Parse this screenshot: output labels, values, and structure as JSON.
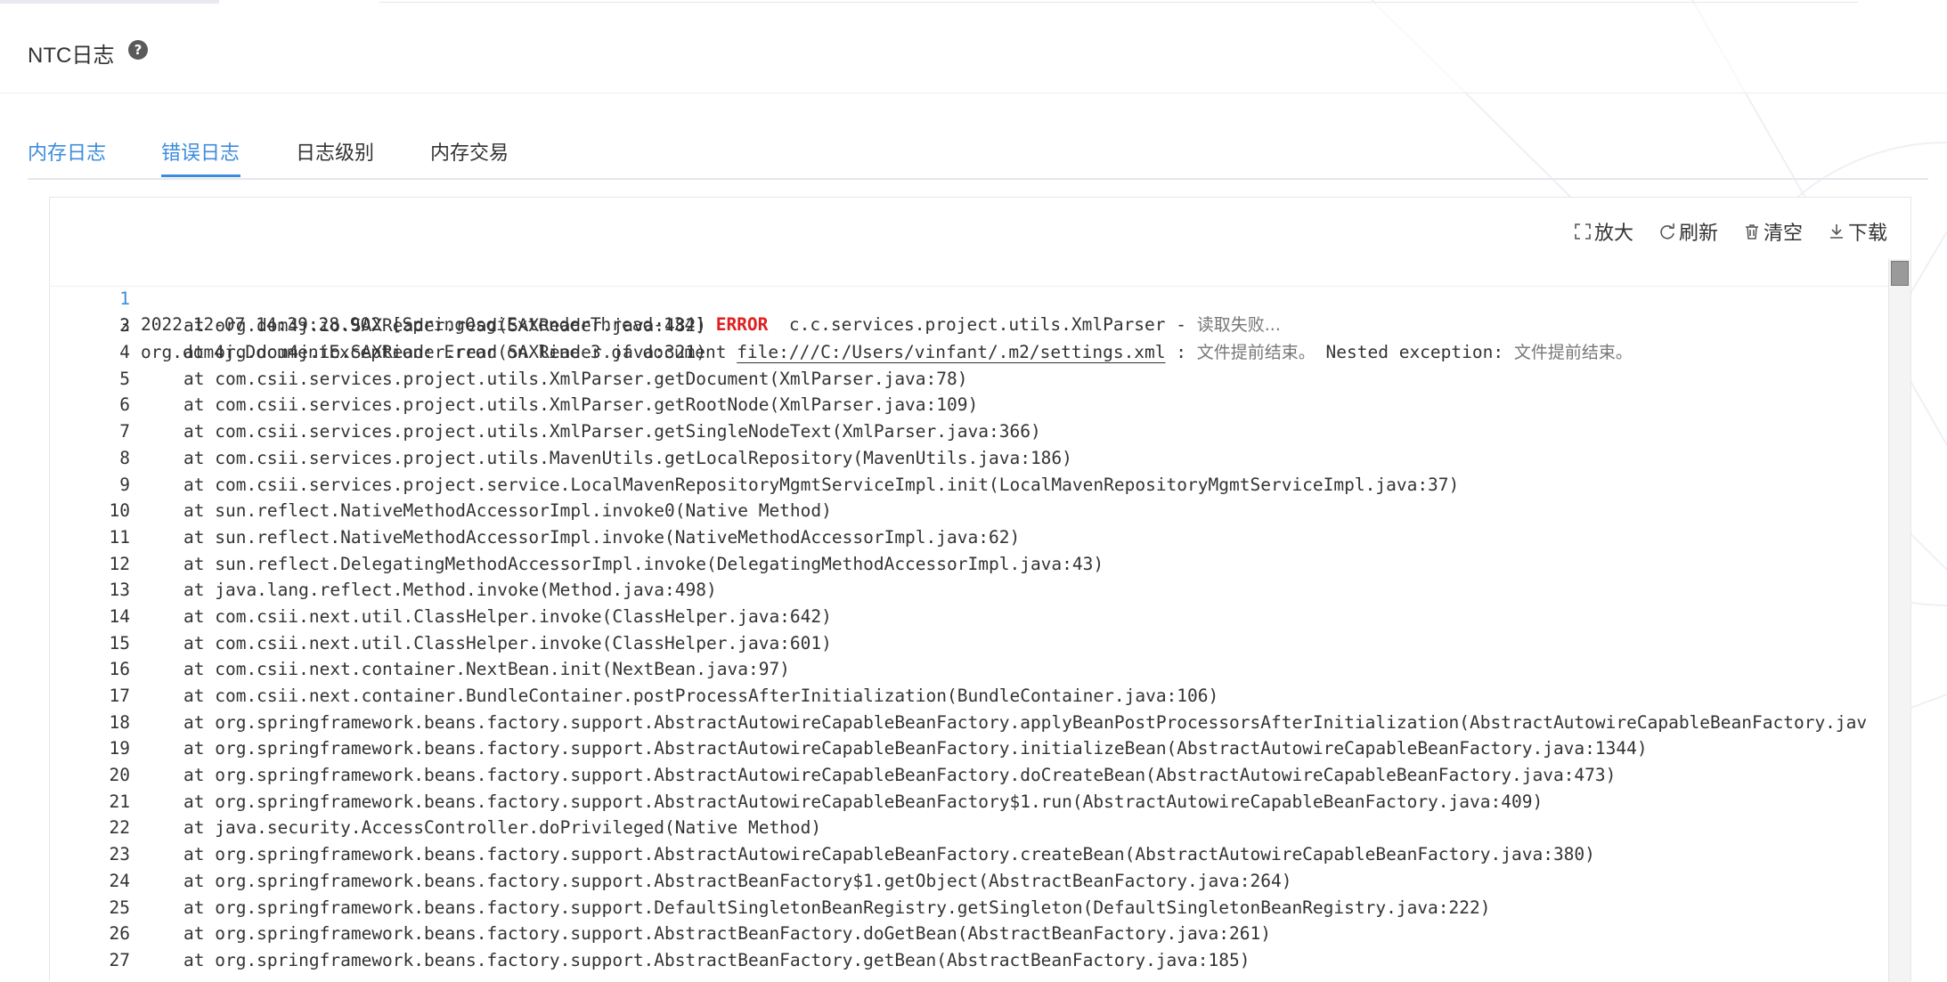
{
  "header": {
    "title": "NTC日志",
    "help_icon": "question-circle-icon"
  },
  "tabs": [
    {
      "label": "内存日志"
    },
    {
      "label": "错误日志"
    },
    {
      "label": "日志级别"
    },
    {
      "label": "内存交易"
    }
  ],
  "toolbar": {
    "zoom_label": "放大",
    "refresh_label": "刷新",
    "clear_label": "清空",
    "download_label": "下载"
  },
  "log": {
    "line1": {
      "num": "1",
      "prefix": "2022-12-07 14:39:28.902 [SpringOsgiExtenderThread-134] ",
      "level": "ERROR",
      "middle": "  c.c.services.project.utils.XmlParser - ",
      "cn": "读取失败..."
    },
    "line2": {
      "num": "2",
      "prefix": "org.dom4j.DocumentException: Error on line 3 of document ",
      "link": "file:///C:/Users/vinfant/.m2/settings.xml",
      "sep1": " : ",
      "cn1": "文件提前结束。",
      "mid": " Nested exception: ",
      "cn2": "文件提前结束。"
    },
    "lines": [
      {
        "num": "3",
        "text": "at org.dom4j.io.SAXReader.read(SAXReader.java:482)"
      },
      {
        "num": "4",
        "text": "at org.dom4j.io.SAXReader.read(SAXReader.java:321)"
      },
      {
        "num": "5",
        "text": "at com.csii.services.project.utils.XmlParser.getDocument(XmlParser.java:78)"
      },
      {
        "num": "6",
        "text": "at com.csii.services.project.utils.XmlParser.getRootNode(XmlParser.java:109)"
      },
      {
        "num": "7",
        "text": "at com.csii.services.project.utils.XmlParser.getSingleNodeText(XmlParser.java:366)"
      },
      {
        "num": "8",
        "text": "at com.csii.services.project.utils.MavenUtils.getLocalRepository(MavenUtils.java:186)"
      },
      {
        "num": "9",
        "text": "at com.csii.services.project.service.LocalMavenRepositoryMgmtServiceImpl.init(LocalMavenRepositoryMgmtServiceImpl.java:37)"
      },
      {
        "num": "10",
        "text": "at sun.reflect.NativeMethodAccessorImpl.invoke0(Native Method)"
      },
      {
        "num": "11",
        "text": "at sun.reflect.NativeMethodAccessorImpl.invoke(NativeMethodAccessorImpl.java:62)"
      },
      {
        "num": "12",
        "text": "at sun.reflect.DelegatingMethodAccessorImpl.invoke(DelegatingMethodAccessorImpl.java:43)"
      },
      {
        "num": "13",
        "text": "at java.lang.reflect.Method.invoke(Method.java:498)"
      },
      {
        "num": "14",
        "text": "at com.csii.next.util.ClassHelper.invoke(ClassHelper.java:642)"
      },
      {
        "num": "15",
        "text": "at com.csii.next.util.ClassHelper.invoke(ClassHelper.java:601)"
      },
      {
        "num": "16",
        "text": "at com.csii.next.container.NextBean.init(NextBean.java:97)"
      },
      {
        "num": "17",
        "text": "at com.csii.next.container.BundleContainer.postProcessAfterInitialization(BundleContainer.java:106)"
      },
      {
        "num": "18",
        "text": "at org.springframework.beans.factory.support.AbstractAutowireCapableBeanFactory.applyBeanPostProcessorsAfterInitialization(AbstractAutowireCapableBeanFactory.jav"
      },
      {
        "num": "19",
        "text": "at org.springframework.beans.factory.support.AbstractAutowireCapableBeanFactory.initializeBean(AbstractAutowireCapableBeanFactory.java:1344)"
      },
      {
        "num": "20",
        "text": "at org.springframework.beans.factory.support.AbstractAutowireCapableBeanFactory.doCreateBean(AbstractAutowireCapableBeanFactory.java:473)"
      },
      {
        "num": "21",
        "text": "at org.springframework.beans.factory.support.AbstractAutowireCapableBeanFactory$1.run(AbstractAutowireCapableBeanFactory.java:409)"
      },
      {
        "num": "22",
        "text": "at java.security.AccessController.doPrivileged(Native Method)"
      },
      {
        "num": "23",
        "text": "at org.springframework.beans.factory.support.AbstractAutowireCapableBeanFactory.createBean(AbstractAutowireCapableBeanFactory.java:380)"
      },
      {
        "num": "24",
        "text": "at org.springframework.beans.factory.support.AbstractBeanFactory$1.getObject(AbstractBeanFactory.java:264)"
      },
      {
        "num": "25",
        "text": "at org.springframework.beans.factory.support.DefaultSingletonBeanRegistry.getSingleton(DefaultSingletonBeanRegistry.java:222)"
      },
      {
        "num": "26",
        "text": "at org.springframework.beans.factory.support.AbstractBeanFactory.doGetBean(AbstractBeanFactory.java:261)"
      },
      {
        "num": "27",
        "text": "at org.springframework.beans.factory.support.AbstractBeanFactory.getBean(AbstractBeanFactory.java:185)"
      }
    ]
  },
  "colors": {
    "accent": "#3c8cdc",
    "error": "#e02020"
  }
}
